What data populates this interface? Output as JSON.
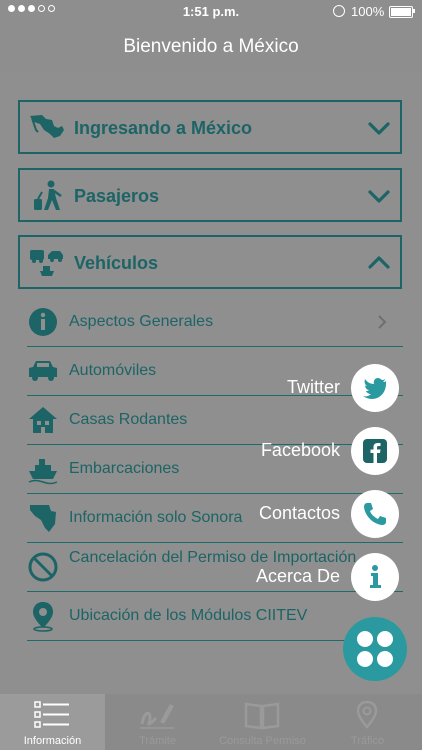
{
  "status_bar": {
    "signal_dots": 5,
    "carrier": "",
    "time": "1:51 p.m.",
    "battery": "100%"
  },
  "header": {
    "title": "Bienvenido a México"
  },
  "accordion": [
    {
      "label": "Ingresando a México",
      "icon": "mexico-map-icon",
      "expanded": false
    },
    {
      "label": "Pasajeros",
      "icon": "traveler-luggage-icon",
      "expanded": false
    },
    {
      "label": "Vehículos",
      "icon": "vehicles-icon",
      "expanded": true
    }
  ],
  "submenu": [
    {
      "label": "Aspectos Generales",
      "icon": "info-circle-icon"
    },
    {
      "label": "Automóviles",
      "icon": "car-icon"
    },
    {
      "label": "Casas Rodantes",
      "icon": "house-icon"
    },
    {
      "label": "Embarcaciones",
      "icon": "ship-icon"
    },
    {
      "label": "Información solo Sonora",
      "icon": "sonora-map-icon"
    },
    {
      "label": "Cancelación del Permiso de Importación",
      "icon": "prohibited-icon"
    },
    {
      "label": "Ubicación de los Módulos CIITEV",
      "icon": "location-pin-icon"
    }
  ],
  "fab_menu": {
    "items": [
      {
        "label": "Twitter",
        "icon": "twitter-bird-icon"
      },
      {
        "label": "Facebook",
        "icon": "facebook-icon"
      },
      {
        "label": "Contactos",
        "icon": "phone-icon"
      },
      {
        "label": "Acerca De",
        "icon": "info-icon"
      }
    ],
    "main_icon": "four-circles-icon"
  },
  "tabs": [
    {
      "label": "Información",
      "icon": "list-icon",
      "active": true
    },
    {
      "label": "Trámite",
      "icon": "signature-icon",
      "active": false
    },
    {
      "label": "Consulta Permiso",
      "icon": "book-icon",
      "active": false
    },
    {
      "label": "Tráfico",
      "icon": "location-pin-icon",
      "active": false
    }
  ],
  "colors": {
    "teal_dark": "#1d6466",
    "teal_accent": "#2a9aa0",
    "overlay_gray": "#8f8f8f",
    "white": "#ffffff"
  }
}
